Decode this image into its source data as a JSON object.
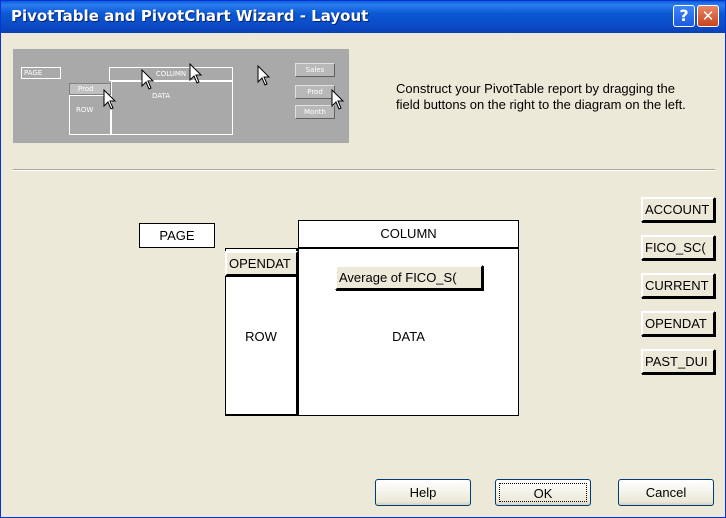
{
  "window": {
    "title": "PivotTable and PivotChart Wizard - Layout",
    "help_glyph": "?",
    "close_glyph": "✕"
  },
  "preview": {
    "page_label": "PAGE",
    "column_label": "COLUMN",
    "row_field_label": "Prod",
    "row_label": "ROW",
    "data_label": "DATA",
    "buttons": [
      "Sales",
      "Prod",
      "Month"
    ]
  },
  "instructions": "Construct your PivotTable report by dragging the field buttons on the right to the diagram on the left.",
  "layout": {
    "page": "PAGE",
    "column": "COLUMN",
    "row": "ROW",
    "data": "DATA",
    "row_field": "OPENDAT",
    "data_field": "Average of FICO_S("
  },
  "fields": [
    "ACCOUNT",
    "FICO_SC(",
    "CURRENT",
    "OPENDAT",
    "PAST_DUI"
  ],
  "buttons": {
    "help": "Help",
    "ok": "OK",
    "cancel": "Cancel"
  }
}
